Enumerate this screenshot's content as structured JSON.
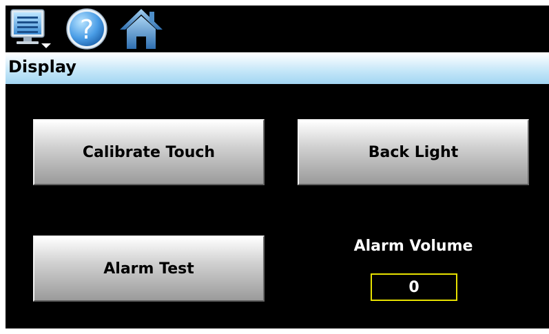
{
  "toolbar": {
    "icons": [
      "monitor-menu-icon",
      "help-icon",
      "home-icon"
    ]
  },
  "header": {
    "title": "Display"
  },
  "buttons": {
    "calibrate_touch": "Calibrate Touch",
    "back_light": "Back Light",
    "alarm_test": "Alarm Test"
  },
  "alarm_volume": {
    "label": "Alarm Volume",
    "value": "0"
  },
  "colors": {
    "background": "#000000",
    "title_bar": "#a2d5f2",
    "button_face": "#d2d2d2",
    "field_border": "#e8e200",
    "text_light": "#ffffff"
  }
}
